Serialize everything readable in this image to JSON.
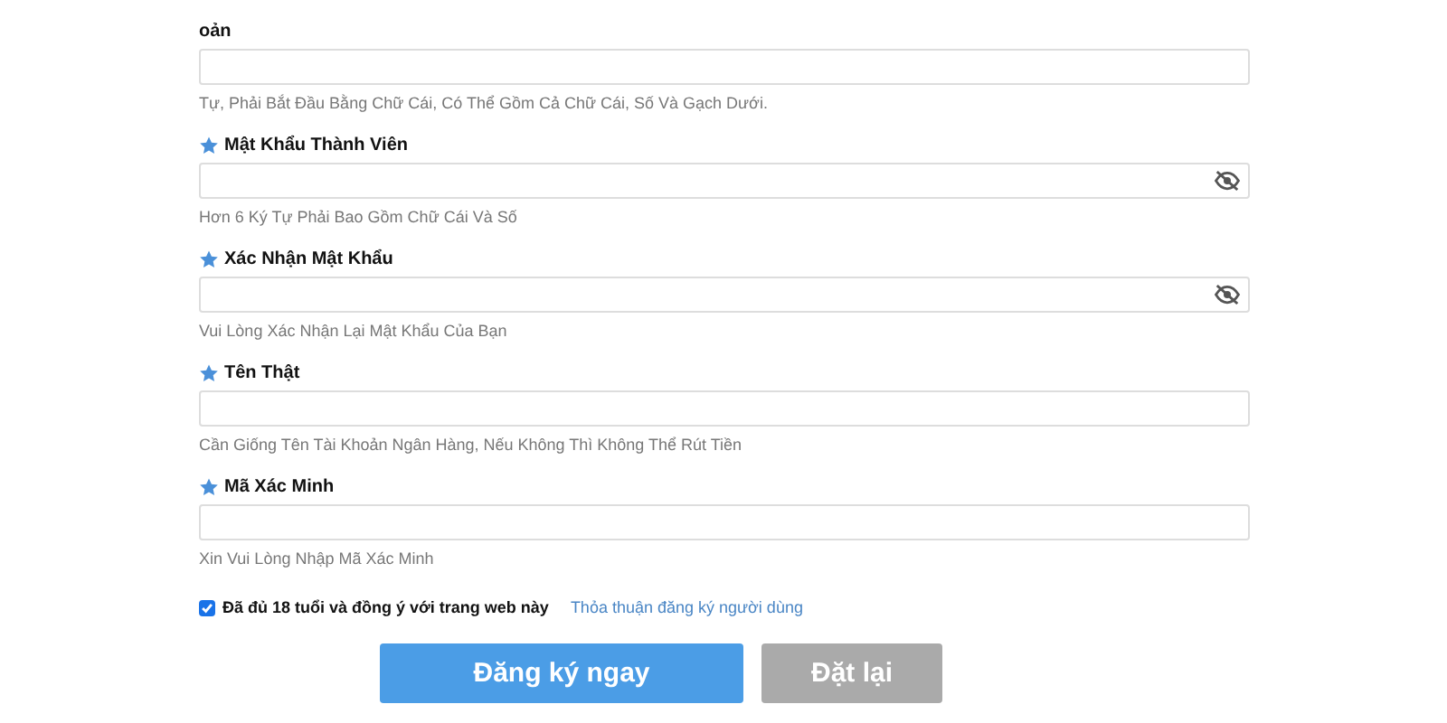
{
  "fields": [
    {
      "label": "oản",
      "required": false,
      "kind": "text",
      "hint": "Tự, Phải Bắt Đầu Bằng Chữ Cái, Có Thể Gồm Cả Chữ Cái, Số Và Gạch Dưới."
    },
    {
      "label": "Mật Khẩu Thành Viên",
      "required": true,
      "kind": "password",
      "hint": "Hơn 6 Ký Tự Phải Bao Gồm Chữ Cái Và Số"
    },
    {
      "label": "Xác Nhận Mật Khẩu",
      "required": true,
      "kind": "password",
      "hint": "Vui Lòng Xác Nhận Lại Mật Khẩu Của Bạn"
    },
    {
      "label": "Tên Thật",
      "required": true,
      "kind": "text",
      "hint": "Cần Giống Tên Tài Khoản Ngân Hàng, Nếu Không Thì Không Thể Rút Tiền"
    },
    {
      "label": "Mã Xác Minh",
      "required": true,
      "kind": "text",
      "hint": "Xin Vui Lòng Nhập Mã Xác Minh"
    }
  ],
  "agreement": {
    "checked": true,
    "label": "Đã đủ 18 tuổi và đồng ý với trang web này",
    "link": "Thỏa thuận đăng ký người dùng"
  },
  "buttons": [
    {
      "label": "Đăng ký ngay",
      "kind": "primary"
    },
    {
      "label": "Đặt lại",
      "kind": "secondary"
    }
  ]
}
